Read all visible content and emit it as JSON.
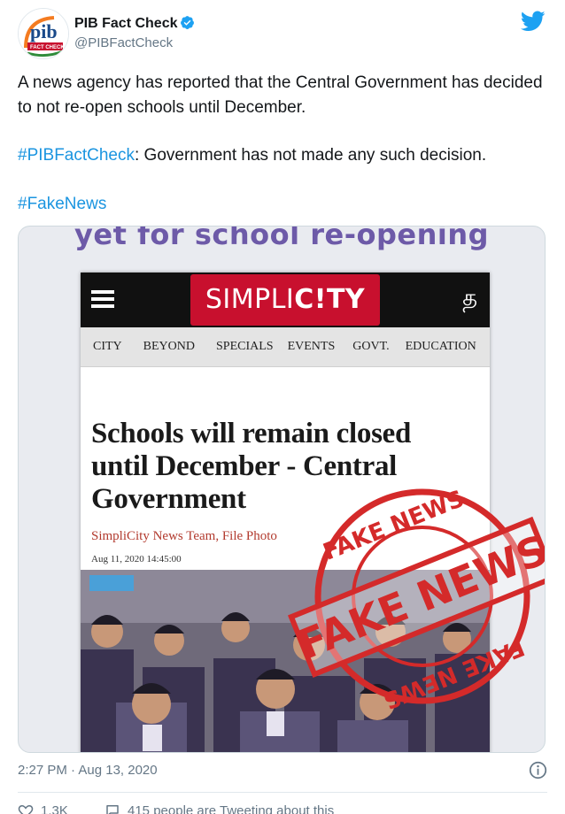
{
  "header": {
    "name": "PIB Fact Check",
    "handle": "@PIBFactCheck",
    "avatar_text": "pib",
    "avatar_sub": "FACT CHECK",
    "verified_icon": "verified-badge-icon",
    "platform_icon": "twitter-bird-icon"
  },
  "tweet": {
    "line1": "A news agency has reported that the Central Government has decided to not re-open schools until December.",
    "hashtag1": "#PIBFactCheck",
    "line2_rest": ": Government has not made any such decision.",
    "hashtag2": "#FakeNews"
  },
  "media": {
    "top_banner": "yet for school re-opening",
    "brand_left": "SIMPLI",
    "brand_right": "C!TY",
    "lang_glyph": "த",
    "nav": [
      "CITY",
      "BEYOND",
      "SPECIALS",
      "EVENTS",
      "GOVT.",
      "EDUCATION"
    ],
    "headline": "Schools will remain closed until December - Central Government",
    "byline": "SimpliCity News Team, File Photo",
    "dateline": "Aug 11, 2020 14:45:00",
    "stamp_text": "FAKE NEWS",
    "stamp_ring": "FAKE NEWS"
  },
  "footer": {
    "timestamp": "2:27 PM · Aug 13, 2020",
    "likes": "1.3K",
    "retweets_text": "415 people are Tweeting about this"
  },
  "colors": {
    "link": "#1b95e0",
    "verified": "#1da1f2",
    "brand_red": "#c8102e",
    "stamp_red": "#d42a2a",
    "banner_purple": "#6d5aa8"
  }
}
